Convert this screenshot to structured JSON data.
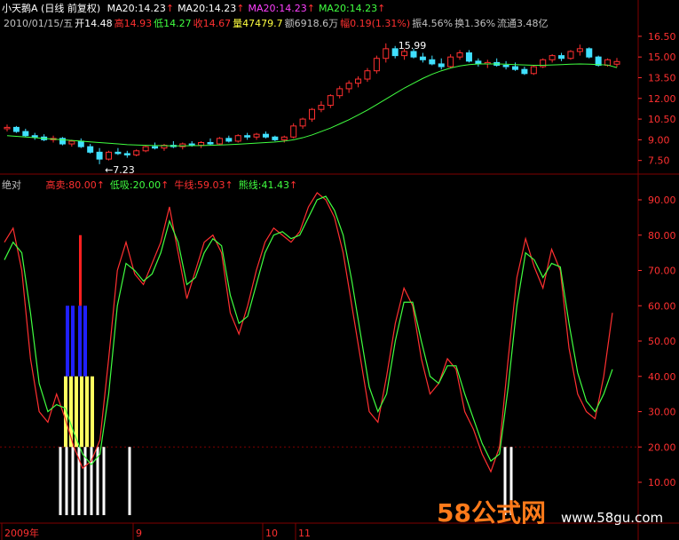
{
  "header": {
    "stock_name": "小天鹅A",
    "period": "(日线 前复权)",
    "ma_items": [
      {
        "label": "MA20:14.23",
        "color": "#ffffff"
      },
      {
        "label": "MA20:14.23",
        "color": "#ffffff"
      },
      {
        "label": "MA20:14.23",
        "color": "#ff40ff"
      },
      {
        "label": "MA20:14.23",
        "color": "#40ff40"
      }
    ],
    "line2": [
      {
        "text": "2010/01/15/五",
        "color": "#c0c0c0"
      },
      {
        "text": "开14.48",
        "color": "#ffffff"
      },
      {
        "text": "高14.93",
        "color": "#ff3030"
      },
      {
        "text": "低14.27",
        "color": "#40ff40"
      },
      {
        "text": "收14.67",
        "color": "#ff3030"
      },
      {
        "text": "量47479.7",
        "color": "#ffff40"
      },
      {
        "text": "额6918.6万",
        "color": "#c0c0c0"
      },
      {
        "text": "幅0.19(1.31%)",
        "color": "#ff3030"
      },
      {
        "text": "振4.56%",
        "color": "#c0c0c0"
      },
      {
        "text": "换1.36%",
        "color": "#c0c0c0"
      },
      {
        "text": "流通3.48亿",
        "color": "#c0c0c0"
      }
    ]
  },
  "price_axis": [
    "16.50",
    "15.00",
    "13.50",
    "12.00",
    "10.50",
    "9.00",
    "7.50"
  ],
  "price_annotations": {
    "high": "15.99",
    "low": "7.23"
  },
  "indicator": {
    "name": "绝对",
    "items": [
      {
        "text": "高卖:80.00",
        "color": "#ff3030"
      },
      {
        "text": "低吸:20.00",
        "color": "#40ff40"
      },
      {
        "text": "牛线:59.03",
        "color": "#ff3030"
      },
      {
        "text": "熊线:41.43",
        "color": "#40ff40"
      }
    ]
  },
  "indicator_axis": [
    "90.00",
    "80.00",
    "70.00",
    "60.00",
    "50.00",
    "40.00",
    "30.00",
    "20.00",
    "10.00"
  ],
  "date_axis": [
    {
      "label": "2009年"
    },
    {
      "label": "9"
    },
    {
      "label": "10"
    },
    {
      "label": "11"
    }
  ],
  "watermark": {
    "main": "58公式网",
    "url": "www.58gu.com"
  },
  "colors": {
    "up": "#ff3030",
    "down": "#40e0ff",
    "ma": "#40ff40",
    "bull": "#ff3030",
    "bear": "#40ff40",
    "frame": "#800000"
  },
  "chart_data": [
    {
      "type": "candlestick",
      "title": "小天鹅A (日线 前复权)",
      "ylim": [
        6.9,
        17.2
      ],
      "ohlc": [
        [
          9.8,
          10.1,
          9.6,
          9.9
        ],
        [
          9.9,
          10.0,
          9.5,
          9.6
        ],
        [
          9.6,
          9.8,
          9.2,
          9.3
        ],
        [
          9.3,
          9.5,
          9.0,
          9.2
        ],
        [
          9.2,
          9.4,
          8.9,
          9.0
        ],
        [
          9.0,
          9.3,
          8.8,
          9.1
        ],
        [
          9.1,
          9.2,
          8.6,
          8.7
        ],
        [
          8.7,
          9.0,
          8.5,
          8.9
        ],
        [
          8.9,
          9.1,
          8.4,
          8.5
        ],
        [
          8.5,
          8.7,
          8.0,
          8.1
        ],
        [
          8.1,
          8.4,
          7.23,
          7.6
        ],
        [
          7.6,
          8.2,
          7.5,
          8.1
        ],
        [
          8.1,
          8.4,
          7.9,
          8.0
        ],
        [
          8.0,
          8.2,
          7.7,
          7.9
        ],
        [
          7.9,
          8.3,
          7.8,
          8.2
        ],
        [
          8.2,
          8.6,
          8.1,
          8.5
        ],
        [
          8.5,
          8.8,
          8.3,
          8.4
        ],
        [
          8.4,
          8.7,
          8.2,
          8.6
        ],
        [
          8.6,
          8.9,
          8.4,
          8.5
        ],
        [
          8.5,
          8.8,
          8.3,
          8.7
        ],
        [
          8.7,
          8.9,
          8.5,
          8.6
        ],
        [
          8.6,
          8.9,
          8.4,
          8.8
        ],
        [
          8.8,
          9.1,
          8.6,
          8.7
        ],
        [
          8.7,
          9.2,
          8.6,
          9.1
        ],
        [
          9.1,
          9.3,
          8.8,
          8.9
        ],
        [
          8.9,
          9.4,
          8.8,
          9.3
        ],
        [
          9.3,
          9.5,
          9.0,
          9.2
        ],
        [
          9.2,
          9.5,
          9.0,
          9.4
        ],
        [
          9.4,
          9.6,
          9.1,
          9.2
        ],
        [
          9.2,
          9.3,
          8.9,
          9.0
        ],
        [
          9.0,
          9.3,
          8.8,
          9.2
        ],
        [
          9.2,
          10.2,
          9.1,
          10.0
        ],
        [
          10.0,
          10.6,
          9.8,
          10.5
        ],
        [
          10.5,
          11.3,
          10.3,
          11.2
        ],
        [
          11.2,
          11.8,
          11.0,
          11.5
        ],
        [
          11.5,
          12.3,
          11.3,
          12.2
        ],
        [
          12.2,
          12.9,
          12.0,
          12.7
        ],
        [
          12.7,
          13.3,
          12.4,
          13.1
        ],
        [
          13.1,
          13.6,
          12.8,
          13.4
        ],
        [
          13.4,
          14.2,
          13.2,
          14.0
        ],
        [
          14.0,
          15.1,
          13.8,
          14.9
        ],
        [
          14.9,
          15.99,
          14.6,
          15.6
        ],
        [
          15.6,
          15.8,
          14.9,
          15.1
        ],
        [
          15.1,
          15.6,
          14.8,
          15.4
        ],
        [
          15.4,
          15.6,
          14.9,
          15.0
        ],
        [
          15.0,
          15.3,
          14.6,
          14.8
        ],
        [
          14.8,
          15.1,
          14.4,
          14.5
        ],
        [
          14.5,
          14.9,
          14.1,
          14.3
        ],
        [
          14.3,
          15.2,
          14.2,
          15.0
        ],
        [
          15.0,
          15.5,
          14.8,
          15.3
        ],
        [
          15.3,
          15.5,
          14.6,
          14.7
        ],
        [
          14.7,
          14.9,
          14.3,
          14.5
        ],
        [
          14.5,
          14.8,
          14.2,
          14.6
        ],
        [
          14.6,
          14.9,
          14.3,
          14.4
        ],
        [
          14.4,
          14.7,
          14.1,
          14.3
        ],
        [
          14.3,
          14.6,
          14.0,
          14.1
        ],
        [
          14.1,
          14.3,
          13.7,
          13.8
        ],
        [
          13.8,
          14.4,
          13.7,
          14.3
        ],
        [
          14.3,
          14.9,
          14.2,
          14.8
        ],
        [
          14.8,
          15.2,
          14.6,
          15.1
        ],
        [
          15.1,
          15.3,
          14.7,
          14.9
        ],
        [
          14.9,
          15.5,
          14.8,
          15.4
        ],
        [
          15.4,
          15.9,
          15.1,
          15.6
        ],
        [
          15.6,
          15.7,
          14.9,
          15.0
        ],
        [
          15.0,
          15.1,
          14.3,
          14.4
        ],
        [
          14.4,
          14.9,
          14.3,
          14.8
        ],
        [
          14.48,
          14.93,
          14.27,
          14.67
        ]
      ],
      "ma20": [
        9.3,
        9.25,
        9.2,
        9.15,
        9.1,
        9.05,
        9.0,
        8.95,
        8.9,
        8.85,
        8.8,
        8.75,
        8.7,
        8.65,
        8.62,
        8.6,
        8.58,
        8.57,
        8.56,
        8.56,
        8.57,
        8.58,
        8.6,
        8.62,
        8.65,
        8.68,
        8.72,
        8.76,
        8.8,
        8.84,
        8.9,
        9.0,
        9.15,
        9.35,
        9.6,
        9.85,
        10.15,
        10.45,
        10.8,
        11.15,
        11.55,
        11.95,
        12.35,
        12.75,
        13.1,
        13.45,
        13.75,
        14.0,
        14.2,
        14.35,
        14.45,
        14.5,
        14.5,
        14.5,
        14.48,
        14.45,
        14.42,
        14.4,
        14.4,
        14.42,
        14.45,
        14.48,
        14.5,
        14.48,
        14.45,
        14.42,
        14.23
      ]
    },
    {
      "type": "line",
      "title": "绝对",
      "ylim": [
        5,
        95
      ],
      "series": [
        {
          "name": "牛线",
          "color": "#ff3030",
          "values": [
            78,
            82,
            70,
            45,
            30,
            27,
            35,
            28,
            20,
            14,
            16,
            22,
            45,
            70,
            78,
            69,
            66,
            72,
            78,
            88,
            75,
            62,
            70,
            78,
            80,
            75,
            58,
            52,
            60,
            70,
            78,
            82,
            80,
            78,
            81,
            88,
            92,
            90,
            85,
            75,
            60,
            45,
            30,
            27,
            40,
            55,
            65,
            60,
            45,
            35,
            38,
            45,
            42,
            30,
            25,
            18,
            13,
            20,
            45,
            68,
            79,
            71,
            65,
            76,
            70,
            48,
            35,
            30,
            28,
            40,
            58
          ]
        },
        {
          "name": "熊线",
          "color": "#40ff40",
          "values": [
            73,
            78,
            75,
            58,
            38,
            30,
            32,
            31,
            24,
            18,
            15,
            18,
            35,
            60,
            72,
            70,
            67,
            69,
            75,
            84,
            78,
            66,
            68,
            75,
            79,
            77,
            63,
            55,
            57,
            66,
            75,
            80,
            81,
            79,
            80,
            85,
            90,
            91,
            87,
            80,
            67,
            52,
            37,
            30,
            35,
            50,
            61,
            61,
            50,
            40,
            38,
            43,
            43,
            35,
            28,
            21,
            16,
            18,
            37,
            60,
            75,
            73,
            68,
            72,
            71,
            55,
            41,
            33,
            30,
            35,
            42
          ]
        }
      ],
      "bars": {
        "blue_top": 60,
        "blue_bottom": 40,
        "yellow_top": 40,
        "yellow_bottom": 20,
        "red_top": 80,
        "red_bottom": 60,
        "white_top": 20,
        "white_bottom": 6
      }
    }
  ]
}
